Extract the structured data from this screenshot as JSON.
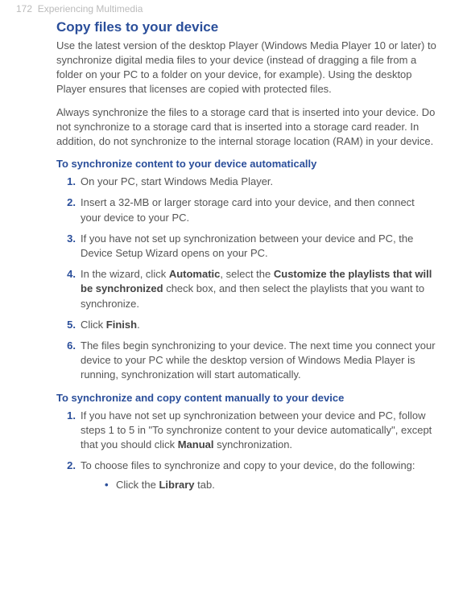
{
  "header": {
    "page_num": "172",
    "chapter": "Experiencing Multimedia"
  },
  "section": {
    "title": "Copy files to your device",
    "p1": "Use the latest version of the desktop Player (Windows Media Player 10 or later) to synchronize digital media files to your device (instead of dragging a file from a folder on your PC to a folder on your device, for example). Using the desktop Player ensures that licenses are copied with protected files.",
    "p2": "Always synchronize the files to a storage card that is inserted into your device. Do not synchronize to a storage card that is inserted into a storage card reader. In addition, do not synchronize to the internal storage location (RAM) in your device."
  },
  "auto": {
    "heading": "To synchronize content to your device automatically",
    "items": {
      "n1": "1.",
      "t1": "On your PC, start Windows Media Player.",
      "n2": "2.",
      "t2": "Insert a 32-MB or larger storage card into your device, and then connect your device to your PC.",
      "n3": "3.",
      "t3": "If you have not set up synchronization between your device and PC, the Device Setup Wizard opens on your PC.",
      "n4": "4.",
      "t4a": "In the wizard, click ",
      "t4b": "Automatic",
      "t4c": ", select the ",
      "t4d": "Customize the playlists that will be synchronized",
      "t4e": " check box, and then select the playlists that you want to synchronize.",
      "n5": "5.",
      "t5a": "Click ",
      "t5b": "Finish",
      "t5c": ".",
      "n6": "6.",
      "t6": "The files begin synchronizing to your device. The next time you connect your device to your PC while the desktop version of Windows Media Player is running, synchronization will start automatically."
    }
  },
  "manual": {
    "heading": "To synchronize and copy content manually to your device",
    "items": {
      "n1": "1.",
      "t1a": "If you have not set up synchronization between your device and PC, follow steps 1 to 5 in \"To synchronize content to your device automatically\", except that you should click ",
      "t1b": "Manual",
      "t1c": " synchronization.",
      "n2": "2.",
      "t2": "To choose files to synchronize and copy to your device, do the following:",
      "bullet": "•",
      "sub_a": "Click the ",
      "sub_b": "Library",
      "sub_c": " tab."
    }
  }
}
